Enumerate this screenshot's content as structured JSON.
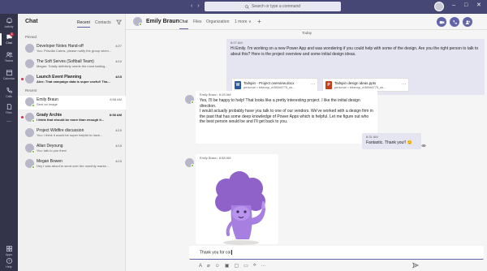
{
  "titlebar": {
    "search_placeholder": "Search or type a command",
    "controls": [
      "–",
      "□",
      "✕"
    ]
  },
  "rail": {
    "items": [
      {
        "label": "Activity",
        "icon": "bell-icon",
        "active": false
      },
      {
        "label": "Chat",
        "icon": "chat-icon",
        "active": true,
        "badge": "3"
      },
      {
        "label": "Teams",
        "icon": "teams-icon",
        "active": false
      },
      {
        "label": "Calendar",
        "icon": "calendar-icon",
        "active": false
      },
      {
        "label": "Calls",
        "icon": "phone-icon",
        "active": false
      },
      {
        "label": "Files",
        "icon": "files-icon",
        "active": false
      },
      {
        "label": "...",
        "icon": "more-icon",
        "active": false
      }
    ],
    "bottom": [
      {
        "label": "Apps",
        "icon": "apps-icon"
      },
      {
        "label": "Help",
        "icon": "help-icon"
      }
    ]
  },
  "chatlist": {
    "title": "Chat",
    "tabs": [
      "Recent",
      "Contacts"
    ],
    "pinned_label": "Pinned",
    "recent_label": "Recent",
    "pinned": [
      {
        "name": "Developer Notes Hand-off",
        "time": "4/27",
        "preview": "You: Priscilla Cairns, please notify the group when...",
        "bold": false
      },
      {
        "name": "The Soft Serves (Softball Team)",
        "time": "4/10",
        "preview": "Megan: Totally definitely needs the most batting...",
        "bold": false
      },
      {
        "name": "Launch Event Planning",
        "time": "4/15",
        "preview": "Alex: That campaign data is super useful! Tha...",
        "bold": true
      }
    ],
    "recent": [
      {
        "name": "Emily Braun",
        "time": "8:58 AM",
        "preview": "Sent an image",
        "bold": false,
        "selected": true
      },
      {
        "name": "Grady Archie",
        "time": "8:58 AM",
        "preview": "I think that should be more than enough ti...",
        "bold": true,
        "selected": false
      },
      {
        "name": "Project Wildfire discussion",
        "time": "4/15",
        "preview": "You: I think it would be super helpful to have...",
        "bold": false,
        "selected": false
      },
      {
        "name": "Allan Deyoung",
        "time": "4/15",
        "preview": "You: talk to you then!",
        "bold": false,
        "selected": false
      },
      {
        "name": "Megan Bowen",
        "time": "4/15",
        "preview": "Hey I was about to send over the monthly marke...",
        "bold": false,
        "selected": false
      }
    ]
  },
  "header": {
    "name": "Emily Braun",
    "tabs": [
      "Chat",
      "Files",
      "Organization",
      "1 more ∨"
    ],
    "plus": "+"
  },
  "conversation": {
    "day_label": "Today",
    "msg1": {
      "time": "8:27 AM",
      "text": "Hi Emily.  I'm working on a new Power App and was wondering if you could help with some of the design.  Are you the right person to talk to about this?  Here is the project overview and some initial design ideas."
    },
    "files": [
      {
        "name": "Tailspin - Project overview.docx",
        "path": "personal > blkecop_m365x6775_on...",
        "type": "W",
        "color": "#2b579a"
      },
      {
        "name": "Tailspin design ideas.pptx",
        "path": "personal > blkecop_m365x6775_on...",
        "type": "P",
        "color": "#c43e1c"
      }
    ],
    "msg2": {
      "author": "Emily Braun",
      "time": "8:28 AM",
      "text1": "Yes, I'll be happy to help!  That looks like a pretty interesting project.  I like the initial design direction.",
      "text2": "I would actually probably have you talk to one of our vendors.  We've worked with a design firm in the past that has some deep knowledge of Power Apps which is helpful.  Let me figure out who the best person would be and I'll get back to you."
    },
    "msg3": {
      "time": "8:31 AM",
      "text": "Fantastic.  Thank you!!",
      "emoji": "😊"
    },
    "msg4": {
      "author": "Emily Braun",
      "time": "8:58 AM"
    }
  },
  "compose": {
    "value": "Thank you for coi"
  },
  "colors": {
    "accent": "#6264a7",
    "titlebar": "#464775",
    "rail": "#33344a",
    "presence": "#6bb700"
  }
}
